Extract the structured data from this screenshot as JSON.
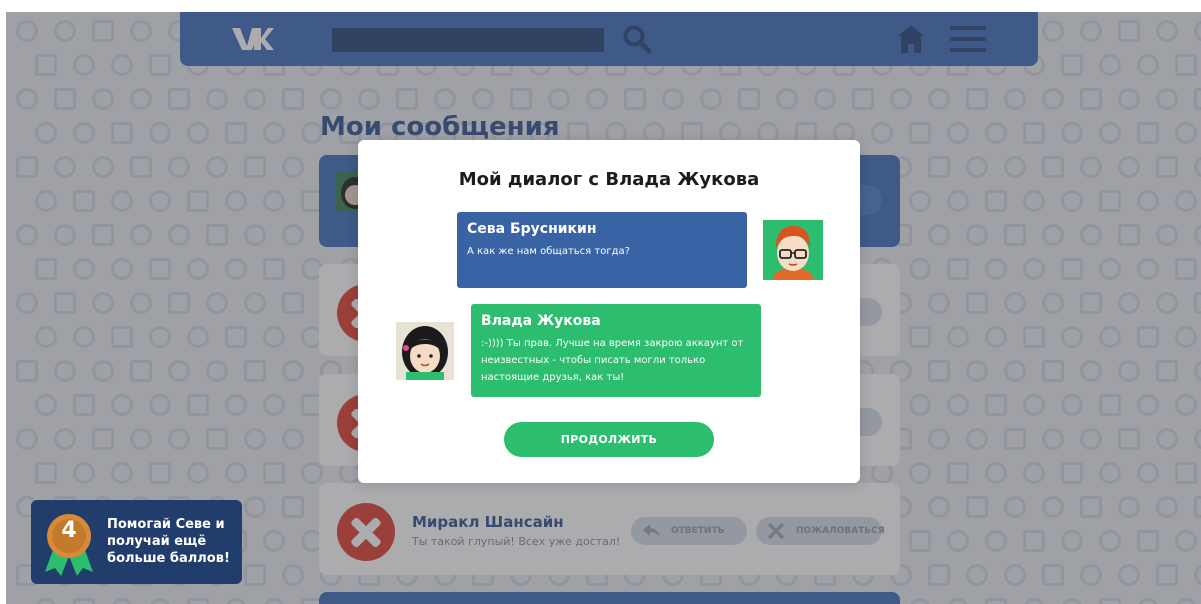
{
  "header": {
    "logo": "VK",
    "search_placeholder": "",
    "icons": [
      "search-icon",
      "home-icon",
      "menu-icon"
    ]
  },
  "page": {
    "title": "Мои сообщения"
  },
  "messages_list": [
    {
      "name": "Миракл Шансайн",
      "text": "Ты такой глупый! Всех уже достал!",
      "reply_label": "ОТВЕТИТЬ",
      "complain_label": "ПОЖАЛОВАТЬСЯ"
    }
  ],
  "dialog": {
    "title": "Мой диалог с Влада Жукова",
    "messages": [
      {
        "author": "Сева Брусникин",
        "text": "А как же нам общаться тогда?"
      },
      {
        "author": "Влада Жукова",
        "text": ":-)))) Ты прав. Лучше на время закрою аккаунт от неизвестных - чтобы писать могли только настоящие друзья, как ты!"
      }
    ],
    "continue_label": "ПРОДОЛЖИТЬ"
  },
  "badge": {
    "points": "4",
    "text": "Помогай Севе и получай ещё больше баллов!"
  },
  "colors": {
    "header_blue": "#3a6bb8",
    "title_blue": "#2a4f8e",
    "green": "#2dbd6e",
    "red": "#e0392b",
    "badge_bg": "#213d6b",
    "medal_orange": "#d98a36"
  }
}
